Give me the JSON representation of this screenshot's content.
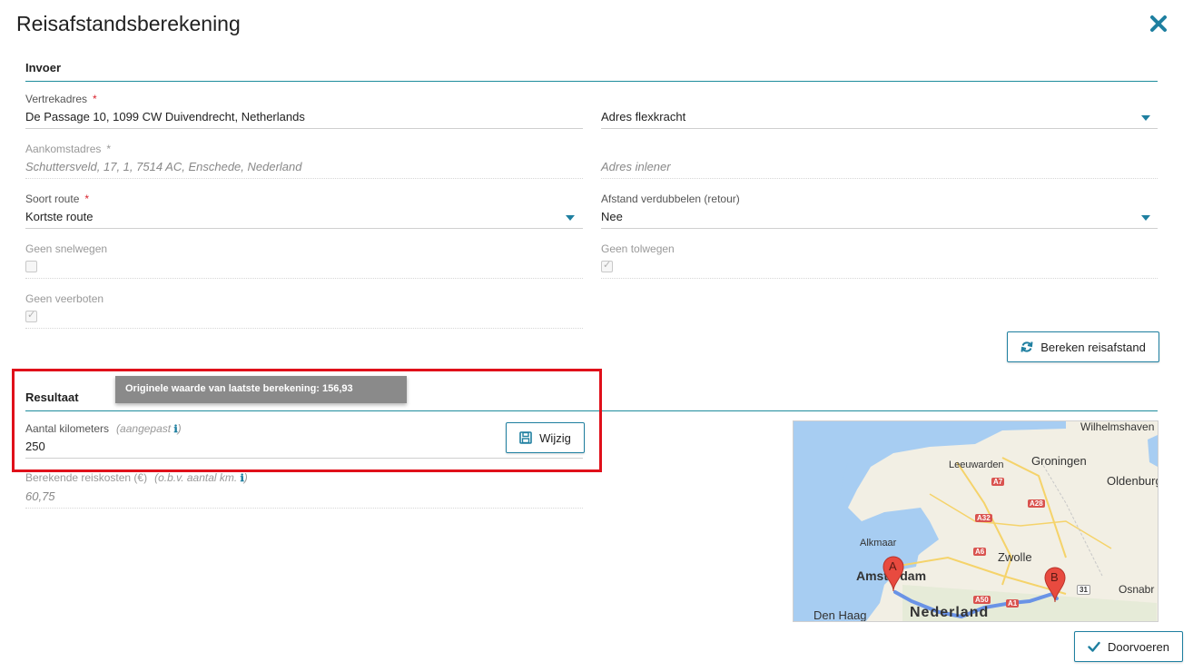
{
  "dialog": {
    "title": "Reisafstandsberekening",
    "close_icon": "close-icon"
  },
  "invoer": {
    "title": "Invoer",
    "vertrek": {
      "label": "Vertrekadres",
      "required": "*",
      "value": "De Passage 10, 1099 CW Duivendrecht, Netherlands"
    },
    "vertrek_option": {
      "value": "Adres flexkracht"
    },
    "aankomst": {
      "label": "Aankomstadres",
      "required": "*",
      "value": "Schuttersveld, 17, 1, 7514 AC, Enschede, Nederland"
    },
    "aankomst_option": {
      "value": "Adres inlener"
    },
    "soort_route": {
      "label": "Soort route",
      "required": "*",
      "value": "Kortste route"
    },
    "verdubbelen": {
      "label": "Afstand verdubbelen (retour)",
      "value": "Nee"
    },
    "geen_snelwegen": {
      "label": "Geen snelwegen",
      "checked": false
    },
    "geen_tolwegen": {
      "label": "Geen tolwegen",
      "checked": true
    },
    "geen_veerboten": {
      "label": "Geen veerboten",
      "checked": true
    },
    "bereken_button": "Bereken reisafstand"
  },
  "tooltip": "Originele waarde van laatste berekening: 156,93",
  "resultaat": {
    "title": "Resultaat",
    "km": {
      "label": "Aantal kilometers",
      "hint": "(aangepast",
      "hint_close": ")",
      "value": "250"
    },
    "wijzig_button": "Wijzig",
    "kosten": {
      "label": "Berekende reiskosten (€)",
      "hint": "(o.b.v. aantal km.",
      "hint_close": ")",
      "value": "60,75"
    }
  },
  "map": {
    "places": [
      "Wilhelmshaven",
      "Groningen",
      "Leeuwarden",
      "Oldenburg",
      "Alkmaar",
      "Zwolle",
      "Amsterdam",
      "Osnabr",
      "Den Haag",
      "Nederland"
    ],
    "roads": [
      "A7",
      "A28",
      "A32",
      "A6",
      "A50",
      "A1",
      "31"
    ],
    "markers": [
      "A",
      "B"
    ]
  },
  "footer": {
    "doorvoeren_button": "Doorvoeren"
  },
  "colors": {
    "accent": "#1e7fa0",
    "line": "#1e8c9c",
    "required": "#d9232d",
    "highlight": "#e0101a"
  }
}
